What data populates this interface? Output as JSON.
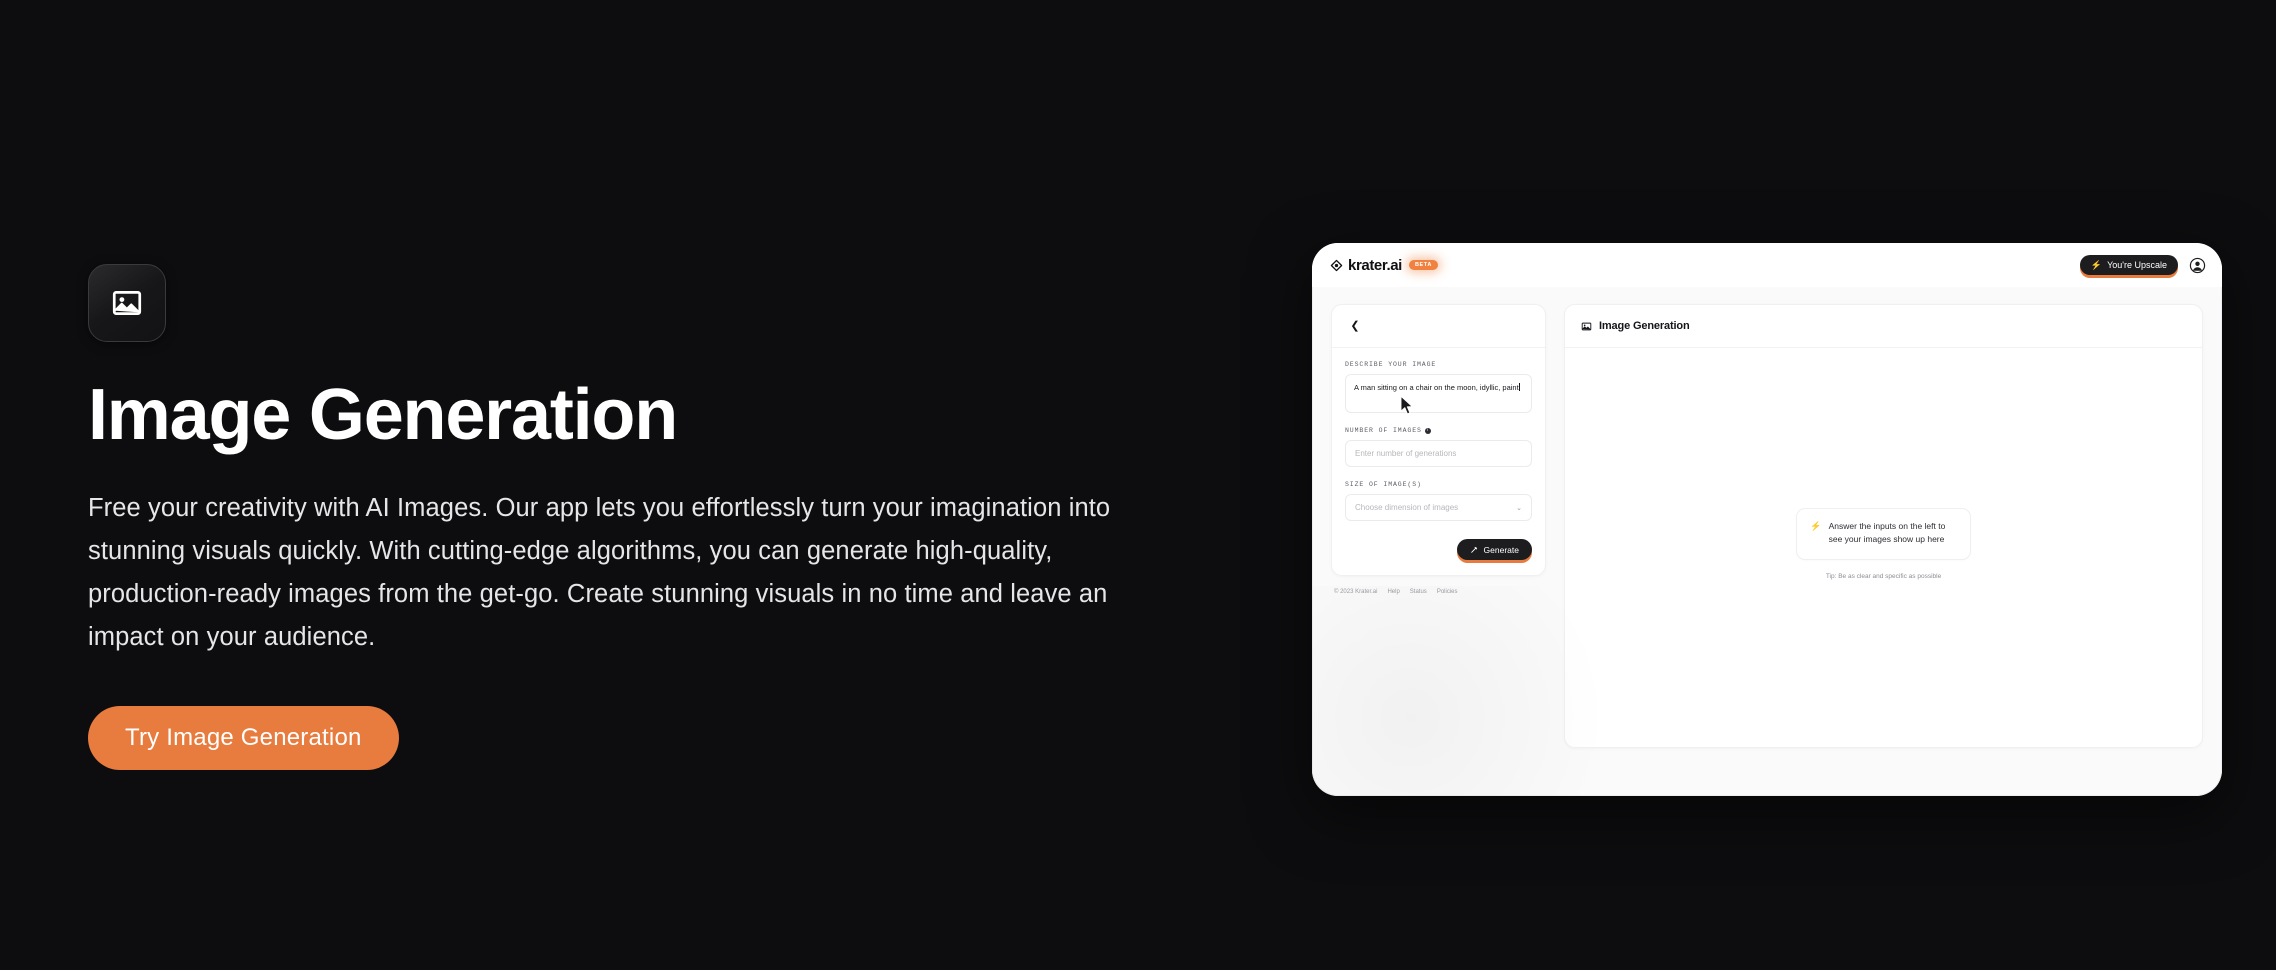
{
  "theme": {
    "page_bg": "#0d0d0f",
    "accent": "#e87b3e",
    "text_primary": "#ffffff",
    "text_secondary": "#e6e6e8"
  },
  "hero": {
    "icon": "image-icon",
    "title": "Image Generation",
    "paragraph": "Free your creativity with AI Images. Our app lets you effortlessly turn your imagination into stunning visuals quickly. With cutting-edge algorithms, you can generate high-quality, production-ready images from the get-go. Create stunning visuals in no time and leave an impact on your audience.",
    "cta_label": "Try Image Generation"
  },
  "app": {
    "topbar": {
      "logo_icon": "krater-diamond-icon",
      "brand_name": "krater.ai",
      "brand_badge": "BETA",
      "upscale_button": {
        "icon": "lightning-bolt-icon",
        "label": "You're Upscale"
      },
      "avatar_icon": "user-avatar-icon"
    },
    "form_panel": {
      "back_icon": "chevron-left-icon",
      "fields": [
        {
          "label": "DESCRIBE YOUR IMAGE",
          "type": "textarea",
          "value": "A man sitting on a chair on the moon, idyllic, paint",
          "placeholder": ""
        },
        {
          "label": "NUMBER OF IMAGES",
          "info_icon": "info-icon",
          "info_glyph": "i",
          "type": "input",
          "value": "",
          "placeholder": "Enter number of generations"
        },
        {
          "label": "SIZE OF IMAGE(S)",
          "type": "select",
          "value": "",
          "placeholder": "Choose dimension of images",
          "caret_icon": "chevron-down-icon"
        }
      ],
      "generate_button": {
        "icon": "magic-wand-icon",
        "label": "Generate"
      },
      "footer": {
        "copyright": "© 2023 Krater.ai",
        "links": [
          "Help",
          "Status",
          "Policies"
        ]
      }
    },
    "result_panel": {
      "header_icon": "image-icon",
      "header_title": "Image Generation",
      "empty_state": {
        "icon": "lightning-bolt-icon",
        "message": "Answer the inputs on the left to see your images show up here",
        "tip": "Tip: Be as clear and specific as possible"
      }
    }
  }
}
